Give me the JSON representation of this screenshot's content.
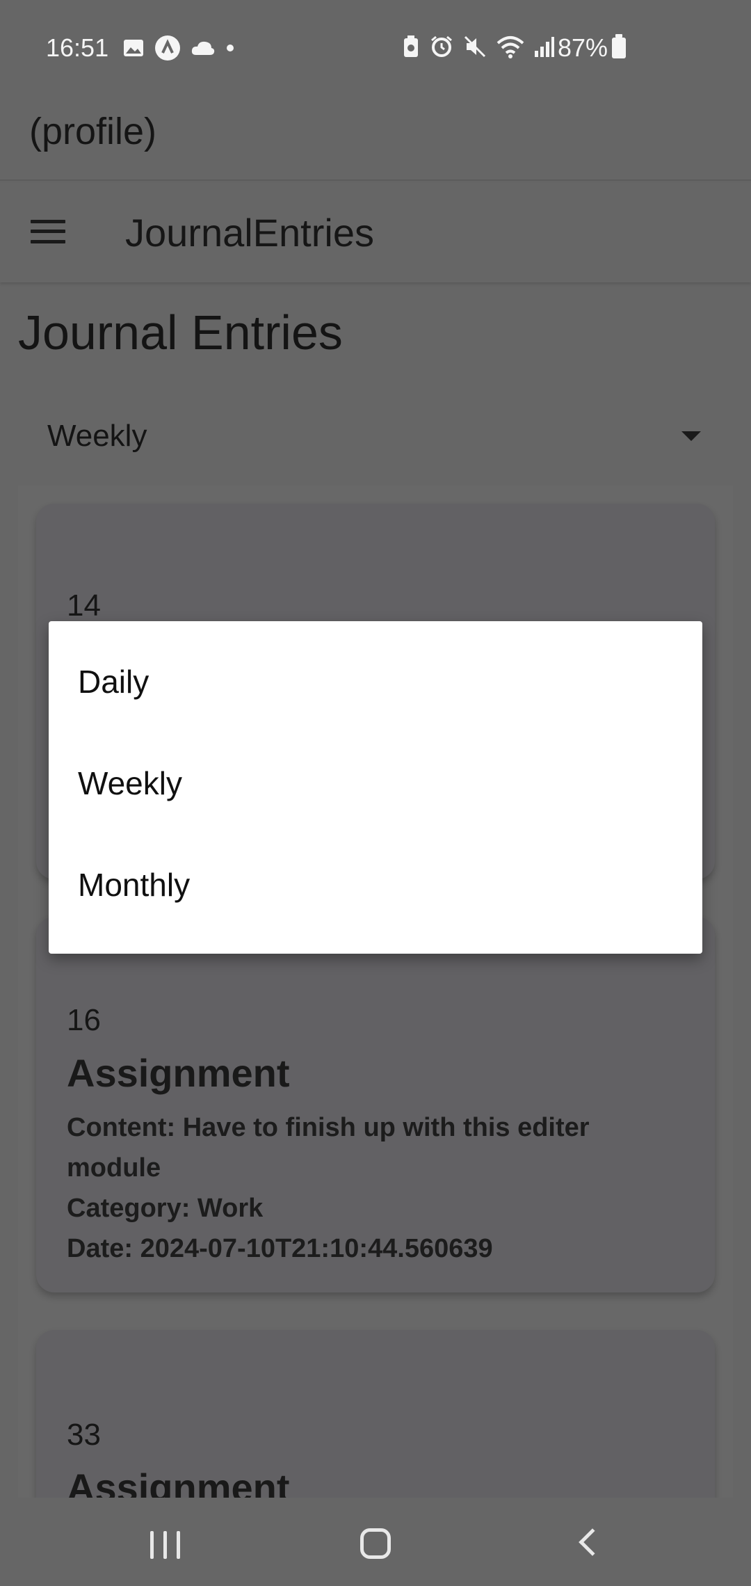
{
  "status_bar": {
    "time": "16:51",
    "battery_percent": "87%",
    "icons": [
      "gallery-icon",
      "app-icon",
      "cloud-icon",
      "dot-icon",
      "battery-saver-icon",
      "alarm-icon",
      "mute-icon",
      "wifi-icon",
      "signal-icon",
      "battery-icon"
    ]
  },
  "profile": {
    "title": "(profile)"
  },
  "appbar": {
    "menu_icon": "hamburger-icon",
    "title": "JournalEntries"
  },
  "page": {
    "title": "Journal Entries"
  },
  "filter": {
    "selected": "Weekly",
    "options": [
      "Daily",
      "Weekly",
      "Monthly"
    ]
  },
  "entries": [
    {
      "id": "14"
    },
    {
      "id": "16",
      "title": "Assignment",
      "content": "Content: Have to finish up with this editer module",
      "category": "Category: Work",
      "date": "Date: 2024-07-10T21:10:44.560639"
    },
    {
      "id": "33",
      "title": "Assignment"
    }
  ],
  "colors": {
    "scrim": "#666666",
    "menu_bg": "#ffffff",
    "card_bg": "#626164"
  }
}
